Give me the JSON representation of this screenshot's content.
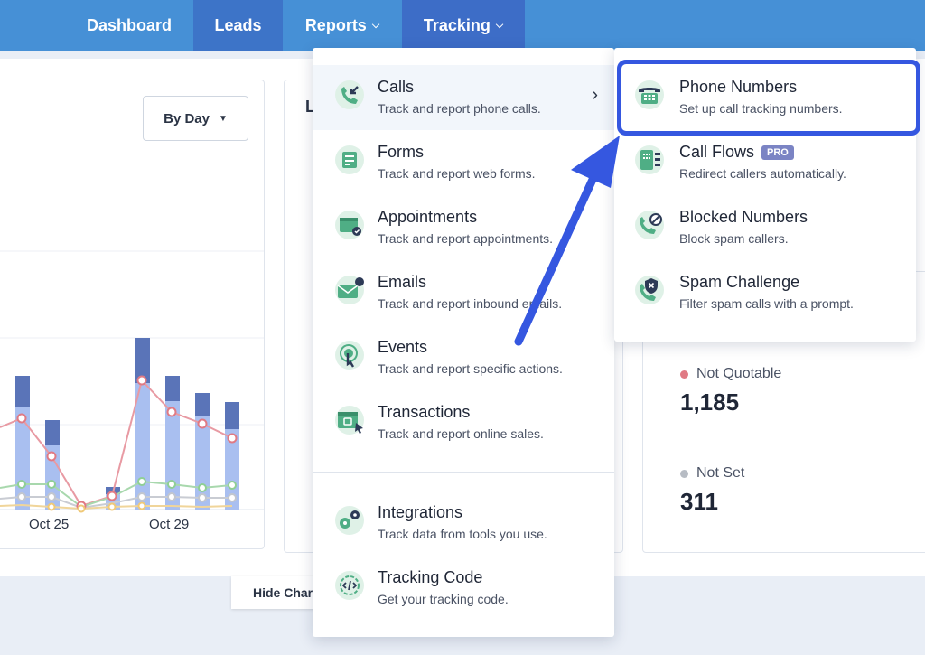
{
  "nav": {
    "dashboard": "Dashboard",
    "leads": "Leads",
    "reports": "Reports",
    "tracking": "Tracking"
  },
  "chart_card": {
    "view_select": "By Day",
    "x_ticks": [
      "Oct 25",
      "Oct 29"
    ]
  },
  "mid_card": {
    "title_fragment": "L"
  },
  "stats": [
    {
      "label": "Not Quotable",
      "value": "1,185",
      "color": "#e07a84"
    },
    {
      "label": "Not Set",
      "value": "311",
      "color": "#b7bcc4"
    }
  ],
  "hide_chart": "Hide Chart",
  "tracking_menu": {
    "items": [
      {
        "title": "Calls",
        "desc": "Track and report phone calls.",
        "icon": "phone-call-icon",
        "has_submenu": true
      },
      {
        "title": "Forms",
        "desc": "Track and report web forms.",
        "icon": "form-icon",
        "has_submenu": true
      },
      {
        "title": "Appointments",
        "desc": "Track and report appointments.",
        "icon": "calendar-icon",
        "has_submenu": false
      },
      {
        "title": "Emails",
        "desc": "Track and report inbound emails.",
        "icon": "email-icon",
        "has_submenu": false
      },
      {
        "title": "Events",
        "desc": "Track and report specific actions.",
        "icon": "touch-icon",
        "has_submenu": false
      },
      {
        "title": "Transactions",
        "desc": "Track and report online sales.",
        "icon": "shopping-bag-icon",
        "has_submenu": false
      },
      {
        "title": "Integrations",
        "desc": "Track data from tools you use.",
        "icon": "gears-icon",
        "has_submenu": false
      },
      {
        "title": "Tracking Code",
        "desc": "Get your tracking code.",
        "icon": "code-icon",
        "has_submenu": false
      }
    ]
  },
  "calls_submenu": {
    "items": [
      {
        "title": "Phone Numbers",
        "desc": "Set up call tracking numbers.",
        "icon": "desk-phone-icon"
      },
      {
        "title": "Call Flows",
        "desc": "Redirect callers automatically.",
        "icon": "call-flow-icon",
        "badge": "PRO"
      },
      {
        "title": "Blocked Numbers",
        "desc": "Block spam callers.",
        "icon": "phone-blocked-icon"
      },
      {
        "title": "Spam Challenge",
        "desc": "Filter spam calls with a prompt.",
        "icon": "phone-shield-icon"
      }
    ]
  },
  "colors": {
    "nav_bg": "#4690d6",
    "nav_active": "#3d6dc7",
    "highlight": "#3557e0",
    "icon_green": "#4fae85"
  }
}
